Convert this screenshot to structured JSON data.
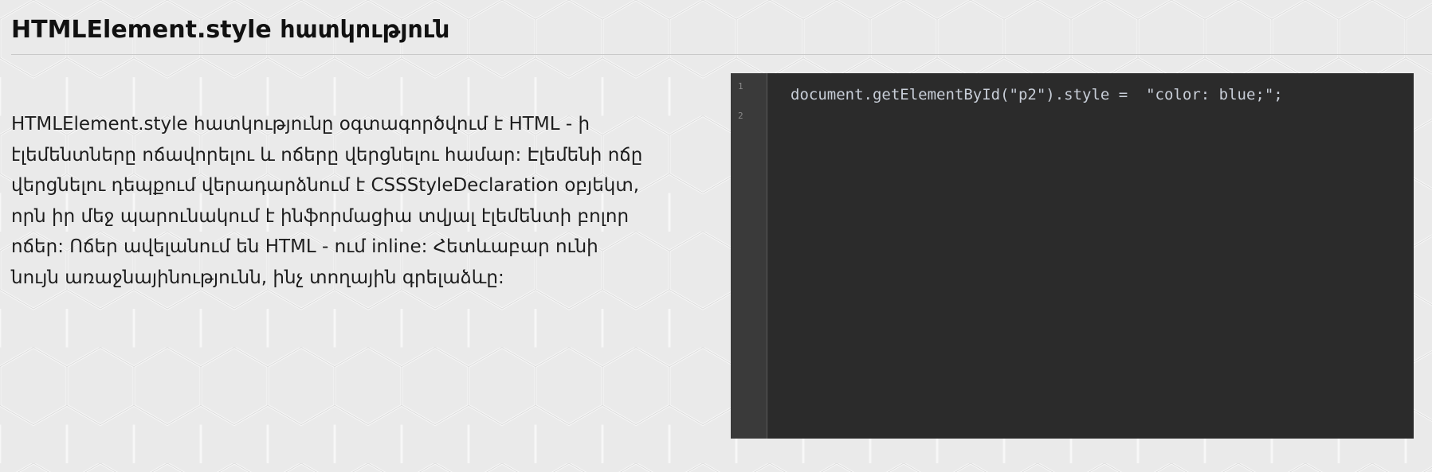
{
  "page": {
    "title": "HTMLElement.style հատկություն"
  },
  "description": {
    "lines": [
      "HTMLElement.style հատկությունը օգտագործվում է HTML - ի",
      "էլեմենտները ոճավորելու և ոճերը վերցնելու համար: Էլեմենի ոճը",
      "վերցնելու դեպքում վերադարձնում է CSSStyleDeclaration օբյեկտ,",
      "որն իր մեջ պարունակում է ինֆորմացիա տվյալ էլեմենտի բոլոր",
      "ոճեր: Ոճեր ավելանում են HTML - ում inline: Հետևաբար ունի",
      "նույն առաջնայինությունն, ինչ տողային գրելաձևը:"
    ]
  },
  "editor": {
    "line_numbers": [
      "1",
      "2"
    ],
    "code_lines": [
      "document.getElementById(\"p2\").style =  \"color: blue;\";",
      ""
    ]
  },
  "colors": {
    "background": "#eaeaea",
    "editor_background": "#2b2b2b",
    "editor_gutter": "#3a3a3a",
    "code_text": "#c8ced8"
  }
}
